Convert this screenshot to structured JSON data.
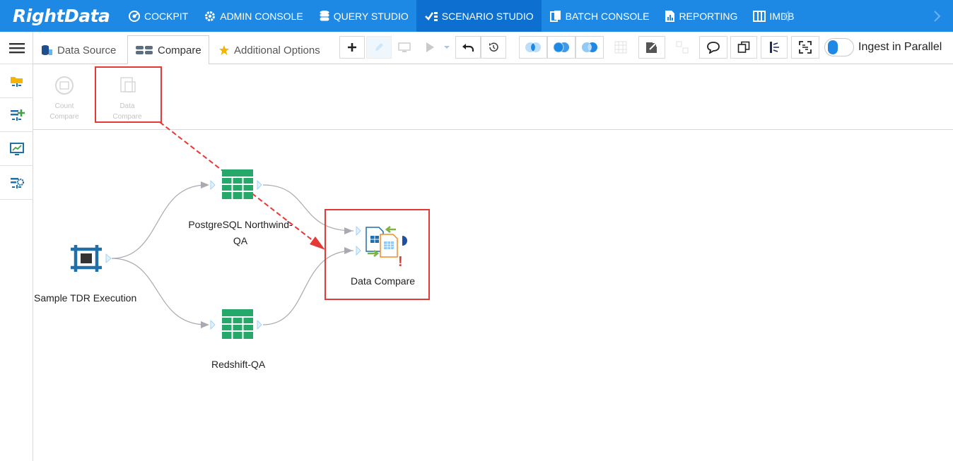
{
  "nav": {
    "logo": "RightData",
    "items": [
      {
        "label": "COCKPIT",
        "icon": "cockpit-icon"
      },
      {
        "label": "ADMIN CONSOLE",
        "icon": "gear-icon"
      },
      {
        "label": "QUERY STUDIO",
        "icon": "database-icon"
      },
      {
        "label": "SCENARIO STUDIO",
        "icon": "scenario-icon"
      },
      {
        "label": "BATCH CONSOLE",
        "icon": "batch-icon"
      },
      {
        "label": "REPORTING",
        "icon": "report-icon"
      },
      {
        "label": "IMDB",
        "icon": "imdb-icon"
      }
    ],
    "active": "SCENARIO STUDIO"
  },
  "tabs": [
    {
      "label": "Data Source",
      "icon": "data-source-icon"
    },
    {
      "label": "Compare",
      "icon": "compare-icon",
      "active": true
    },
    {
      "label": "Additional Options",
      "icon": "star-icon"
    }
  ],
  "toolbar": {
    "toggle_label": "Ingest in Parallel",
    "toggle_on": true
  },
  "palette": {
    "items": [
      {
        "label_line1": "Count",
        "label_line2": "Compare"
      },
      {
        "label_line1": "Data Compare",
        "label_line2": ""
      }
    ]
  },
  "canvas": {
    "nodes": [
      {
        "id": "source",
        "label": "Sample TDR Execution",
        "icon": "execution-icon"
      },
      {
        "id": "postgres",
        "label_line1": "PostgreSQL Northwind-",
        "label_line2": "QA",
        "icon": "table-icon"
      },
      {
        "id": "redshift",
        "label": "Redshift-QA",
        "icon": "table-icon"
      },
      {
        "id": "compare",
        "label": "Data Compare",
        "icon": "data-compare-icon",
        "warning": "!"
      }
    ]
  },
  "colors": {
    "nav_bg": "#1e88e5",
    "nav_active": "#0d6fcf",
    "table_green": "#27a86b",
    "exec_blue": "#1f6fa8",
    "highlight_red": "#e53935",
    "edge_gray": "#a9a9b2"
  }
}
